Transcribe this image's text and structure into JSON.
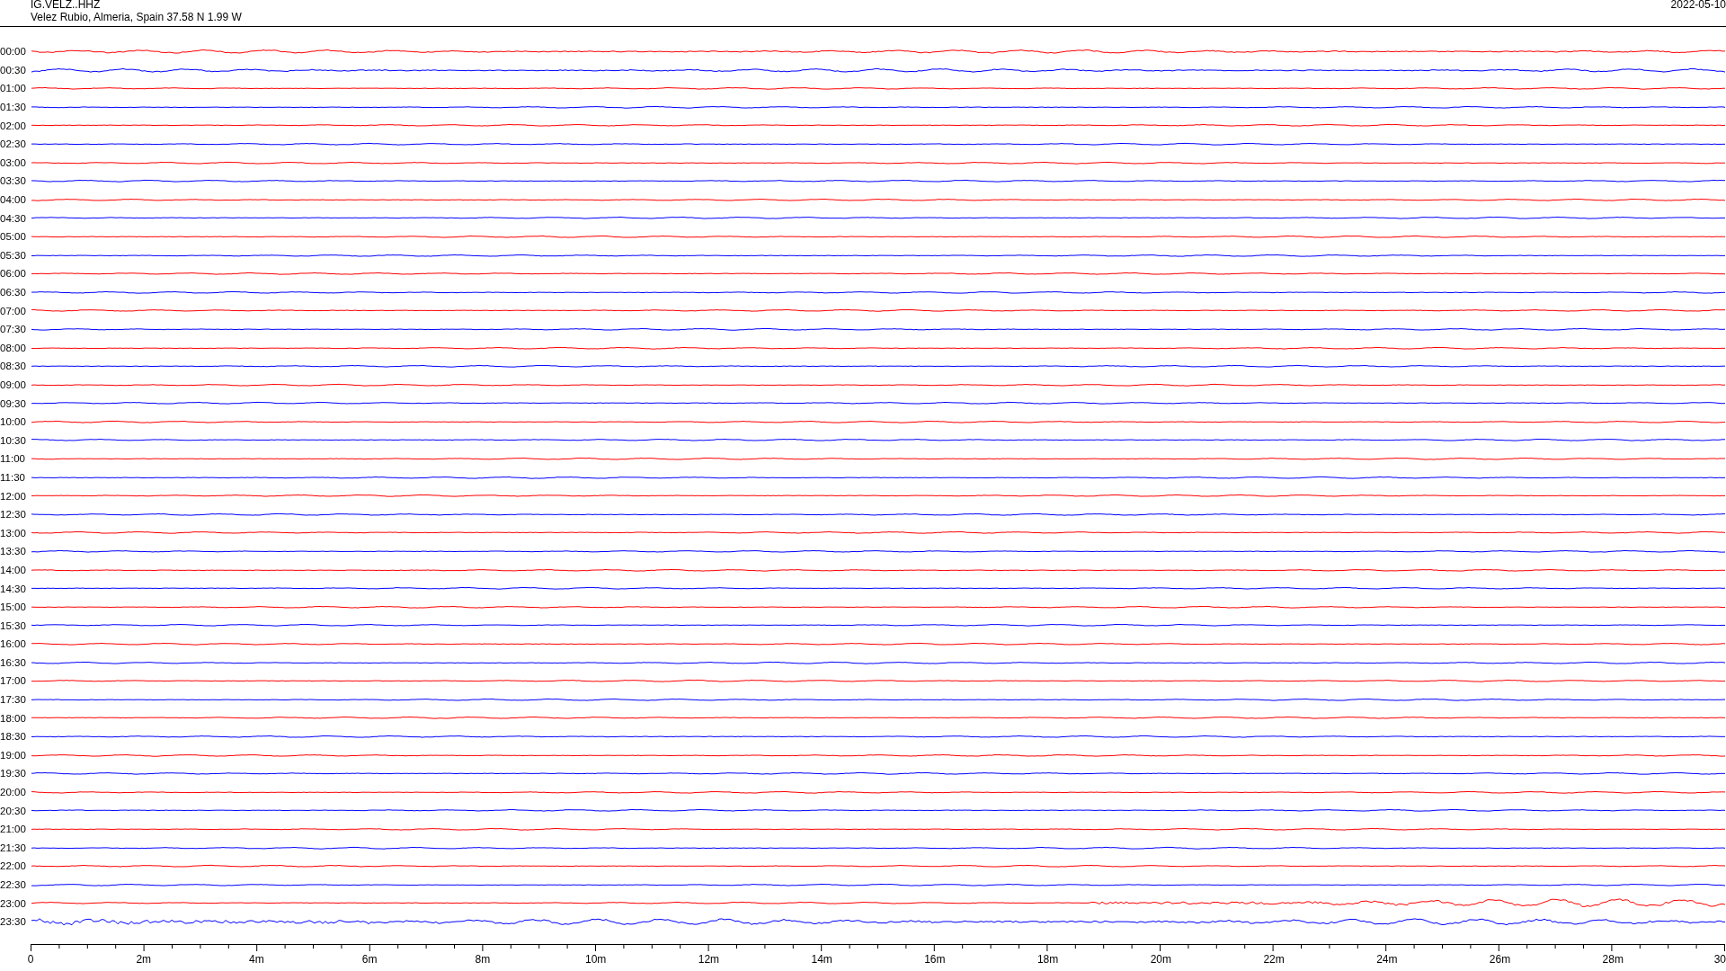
{
  "header": {
    "station": "IG.VELZ..HHZ",
    "location": "Velez Rubio, Almeria, Spain  37.58 N 1.99 W",
    "date": "2022-05-10"
  },
  "rows": [
    {
      "label": "00:00",
      "color": "#ff0000"
    },
    {
      "label": "00:30",
      "color": "#0000ff"
    },
    {
      "label": "01:00",
      "color": "#ff0000"
    },
    {
      "label": "01:30",
      "color": "#0000ff"
    },
    {
      "label": "02:00",
      "color": "#ff0000"
    },
    {
      "label": "02:30",
      "color": "#0000ff"
    },
    {
      "label": "03:00",
      "color": "#ff0000"
    },
    {
      "label": "03:30",
      "color": "#0000ff"
    },
    {
      "label": "04:00",
      "color": "#ff0000"
    },
    {
      "label": "04:30",
      "color": "#0000ff"
    },
    {
      "label": "05:00",
      "color": "#ff0000"
    },
    {
      "label": "05:30",
      "color": "#0000ff"
    },
    {
      "label": "06:00",
      "color": "#ff0000"
    },
    {
      "label": "06:30",
      "color": "#0000ff"
    },
    {
      "label": "07:00",
      "color": "#ff0000"
    },
    {
      "label": "07:30",
      "color": "#0000ff"
    },
    {
      "label": "08:00",
      "color": "#ff0000"
    },
    {
      "label": "08:30",
      "color": "#0000ff"
    },
    {
      "label": "09:00",
      "color": "#ff0000"
    },
    {
      "label": "09:30",
      "color": "#0000ff"
    },
    {
      "label": "10:00",
      "color": "#ff0000"
    },
    {
      "label": "10:30",
      "color": "#0000ff"
    },
    {
      "label": "11:00",
      "color": "#ff0000"
    },
    {
      "label": "11:30",
      "color": "#0000ff"
    },
    {
      "label": "12:00",
      "color": "#ff0000"
    },
    {
      "label": "12:30",
      "color": "#0000ff"
    },
    {
      "label": "13:00",
      "color": "#ff0000"
    },
    {
      "label": "13:30",
      "color": "#0000ff"
    },
    {
      "label": "14:00",
      "color": "#ff0000"
    },
    {
      "label": "14:30",
      "color": "#0000ff"
    },
    {
      "label": "15:00",
      "color": "#ff0000"
    },
    {
      "label": "15:30",
      "color": "#0000ff"
    },
    {
      "label": "16:00",
      "color": "#ff0000"
    },
    {
      "label": "16:30",
      "color": "#0000ff"
    },
    {
      "label": "17:00",
      "color": "#ff0000"
    },
    {
      "label": "17:30",
      "color": "#0000ff"
    },
    {
      "label": "18:00",
      "color": "#ff0000"
    },
    {
      "label": "18:30",
      "color": "#0000ff"
    },
    {
      "label": "19:00",
      "color": "#ff0000"
    },
    {
      "label": "19:30",
      "color": "#0000ff"
    },
    {
      "label": "20:00",
      "color": "#ff0000"
    },
    {
      "label": "20:30",
      "color": "#0000ff"
    },
    {
      "label": "21:00",
      "color": "#ff0000"
    },
    {
      "label": "21:30",
      "color": "#0000ff"
    },
    {
      "label": "22:00",
      "color": "#ff0000"
    },
    {
      "label": "22:30",
      "color": "#0000ff"
    },
    {
      "label": "23:00",
      "color": "#ff0000"
    },
    {
      "label": "23:30",
      "color": "#0000ff"
    }
  ],
  "axis": {
    "ticks": [
      "0",
      "2m",
      "4m",
      "6m",
      "8m",
      "10m",
      "12m",
      "14m",
      "16m",
      "18m",
      "20m",
      "22m",
      "24m",
      "26m",
      "28m",
      "30"
    ]
  }
}
